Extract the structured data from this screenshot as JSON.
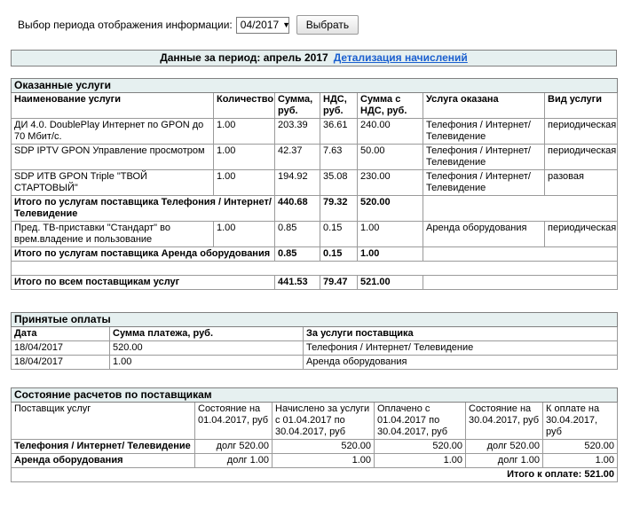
{
  "period_selector": {
    "label": "Выбор периода отображения информации:",
    "selected": "04/2017",
    "button": "Выбрать"
  },
  "period_bar": {
    "text": "Данные за период: апрель 2017",
    "link": "Детализация начислений"
  },
  "services": {
    "title": "Оказанные услуги",
    "headers": [
      "Наименование услуги",
      "Количество",
      "Сумма, руб.",
      "НДС, руб.",
      "Сумма с НДС, руб.",
      "Услуга оказана",
      "Вид услуги"
    ],
    "rows": [
      [
        "ДИ 4.0. DoublePlay Интернет по GPON до 70 Мбит/с.",
        "1.00",
        "203.39",
        "36.61",
        "240.00",
        "Телефония / Интернет/ Телевидение",
        "периодическая"
      ],
      [
        "SDP IPTV GPON Управление просмотром",
        "1.00",
        "42.37",
        "7.63",
        "50.00",
        "Телефония / Интернет/ Телевидение",
        "периодическая"
      ],
      [
        "SDP ИТВ GPON Triple \"ТВОЙ СТАРТОВЫЙ\"",
        "1.00",
        "194.92",
        "35.08",
        "230.00",
        "Телефония / Интернет/ Телевидение",
        "разовая"
      ]
    ],
    "subtotal1": {
      "label": "Итого по услугам поставщика Телефония / Интернет/ Телевидение",
      "sum": "440.68",
      "vat": "79.32",
      "total": "520.00"
    },
    "rows2": [
      [
        "Пред. ТВ-приставки \"Стандарт\" во врем.владение и пользование",
        "1.00",
        "0.85",
        "0.15",
        "1.00",
        "Аренда оборудования",
        "периодическая"
      ]
    ],
    "subtotal2": {
      "label": "Итого по услугам поставщика Аренда оборудования",
      "sum": "0.85",
      "vat": "0.15",
      "total": "1.00"
    },
    "grand": {
      "label": "Итого по всем поставщикам услуг",
      "sum": "441.53",
      "vat": "79.47",
      "total": "521.00"
    }
  },
  "payments": {
    "title": "Принятые оплаты",
    "headers": [
      "Дата",
      "Сумма платежа, руб.",
      "За услуги поставщика"
    ],
    "rows": [
      [
        "18/04/2017",
        "520.00",
        "Телефония / Интернет/ Телевидение"
      ],
      [
        "18/04/2017",
        "1.00",
        "Аренда оборудования"
      ]
    ]
  },
  "settlements": {
    "title": "Состояние расчетов по поставщикам",
    "headers": [
      "Поставщик услуг",
      "Состояние на 01.04.2017, руб",
      "Начислено за услуги с 01.04.2017 по 30.04.2017, руб",
      "Оплачено с 01.04.2017 по 30.04.2017, руб",
      "Состояние на 30.04.2017, руб",
      "К оплате на 30.04.2017, руб"
    ],
    "rows": [
      [
        "Телефония / Интернет/ Телевидение",
        "долг 520.00",
        "520.00",
        "520.00",
        "долг 520.00",
        "520.00"
      ],
      [
        "Аренда оборудования",
        "долг 1.00",
        "1.00",
        "1.00",
        "долг 1.00",
        "1.00"
      ]
    ],
    "total": "Итого к оплате: 521.00"
  }
}
